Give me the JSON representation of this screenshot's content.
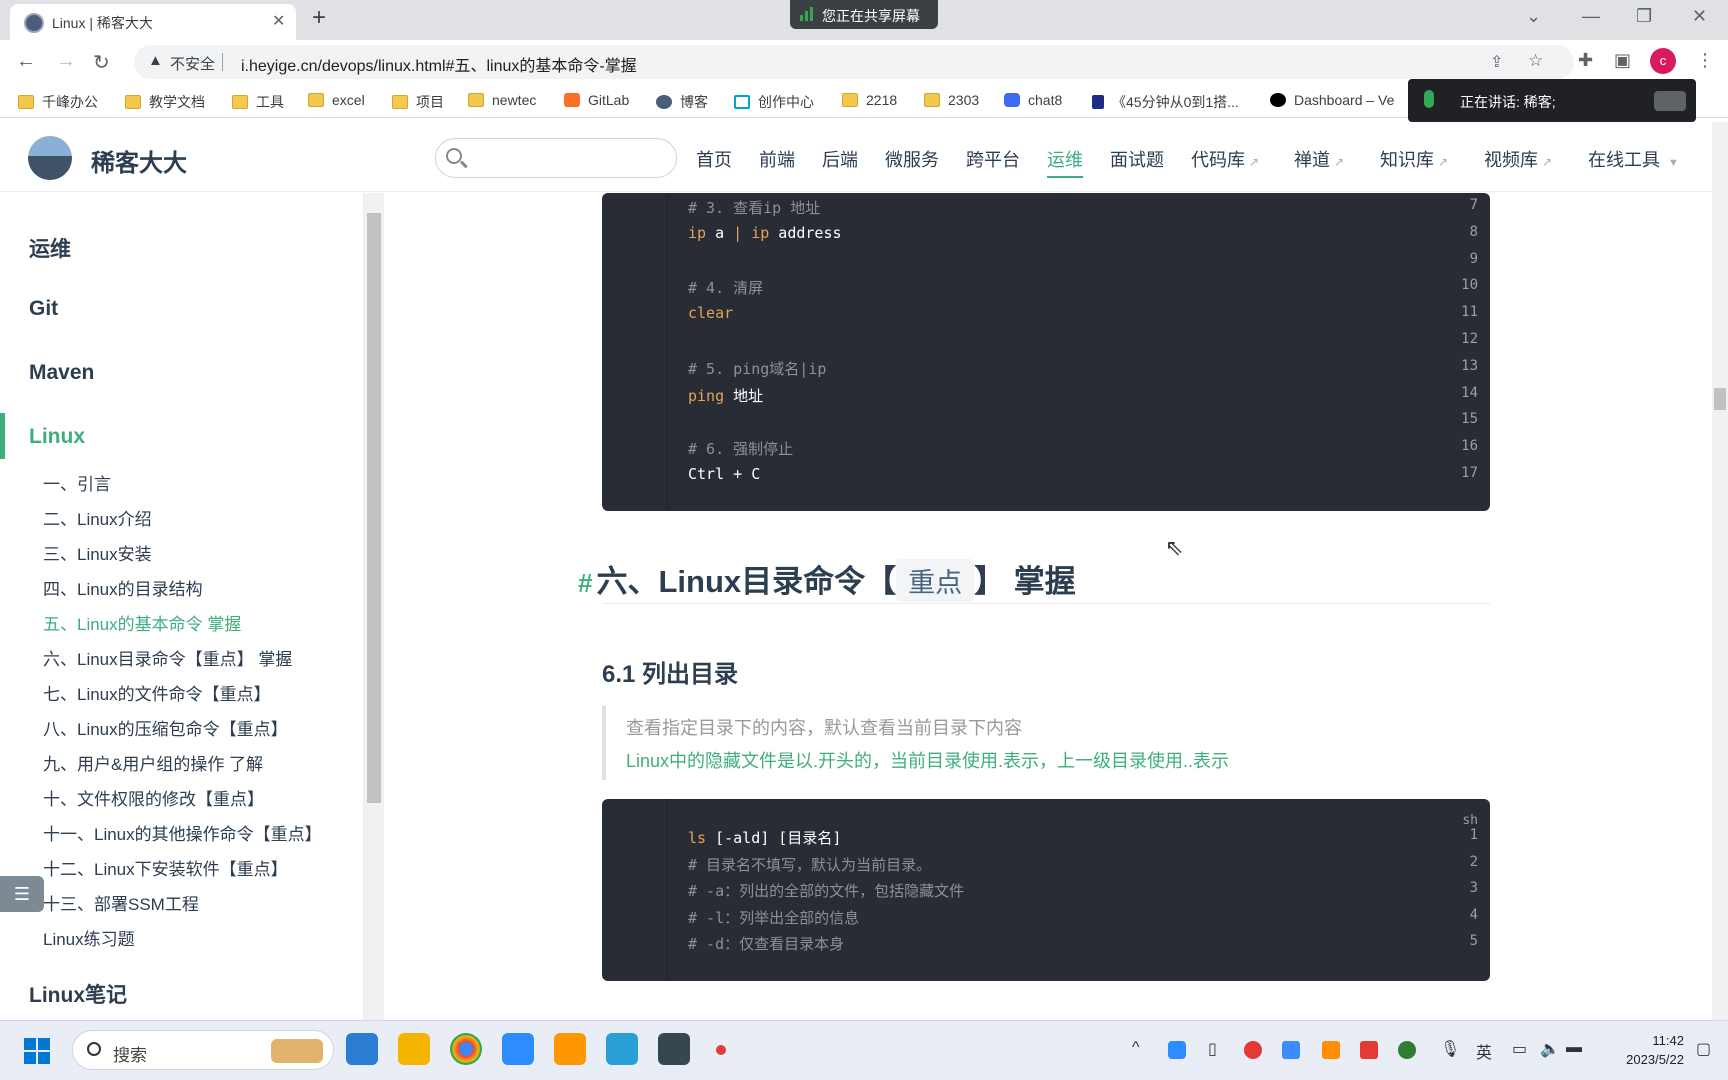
{
  "browser": {
    "tab_title": "Linux | 稀客大大",
    "sharing_banner": "您正在共享屏幕",
    "insecure_label": "不安全",
    "url": "i.heyige.cn/devops/linux.html#五、linux的基本命令-掌握",
    "profile_initial": "c",
    "bookmarks": [
      {
        "label": "千峰办公",
        "icon": "folder"
      },
      {
        "label": "教学文档",
        "icon": "folder"
      },
      {
        "label": "工具",
        "icon": "folder"
      },
      {
        "label": "excel",
        "icon": "folder"
      },
      {
        "label": "项目",
        "icon": "folder"
      },
      {
        "label": "newtec",
        "icon": "folder"
      },
      {
        "label": "GitLab",
        "icon": "gitlab-icon"
      },
      {
        "label": "博客",
        "icon": "blog-icon"
      },
      {
        "label": "创作中心",
        "icon": "bilibili-icon"
      },
      {
        "label": "2218",
        "icon": "folder"
      },
      {
        "label": "2303",
        "icon": "folder"
      },
      {
        "label": "chat8",
        "icon": "chat-icon"
      },
      {
        "label": "《45分钟从0到1搭...",
        "icon": "p-icon"
      },
      {
        "label": "Dashboard – Ve",
        "icon": "vercel-icon"
      }
    ],
    "speaking_label": "正在讲话:  稀客;"
  },
  "site": {
    "name": "稀客大大",
    "search_placeholder": "",
    "nav": [
      {
        "label": "首页",
        "external": false,
        "active": false
      },
      {
        "label": "前端",
        "external": false,
        "active": false
      },
      {
        "label": "后端",
        "external": false,
        "active": false
      },
      {
        "label": "微服务",
        "external": false,
        "active": false
      },
      {
        "label": "跨平台",
        "external": false,
        "active": false
      },
      {
        "label": "运维",
        "external": false,
        "active": true
      },
      {
        "label": "面试题",
        "external": false,
        "active": false
      },
      {
        "label": "代码库",
        "external": true,
        "active": false
      },
      {
        "label": "禅道",
        "external": true,
        "active": false
      },
      {
        "label": "知识库",
        "external": true,
        "active": false
      },
      {
        "label": "视频库",
        "external": true,
        "active": false
      },
      {
        "label": "在线工具",
        "external": false,
        "active": false
      }
    ]
  },
  "sidebar": {
    "groups": [
      "运维",
      "Git",
      "Maven",
      "Linux",
      "Linux笔记"
    ],
    "active_group": "Linux",
    "items": [
      "一、引言",
      "二、Linux介绍",
      "三、Linux安装",
      "四、Linux的目录结构",
      "五、Linux的基本命令 掌握",
      "六、Linux目录命令【重点】 掌握",
      "七、Linux的文件命令【重点】",
      "八、Linux的压缩包命令【重点】",
      "九、用户&用户组的操作 了解",
      "十、文件权限的修改【重点】",
      "十一、Linux的其他操作命令【重点】",
      "十二、Linux下安装软件【重点】",
      "十三、部署SSM工程",
      "Linux练习题"
    ],
    "active_item": "五、Linux的基本命令 掌握"
  },
  "content": {
    "code1": {
      "lines": [
        {
          "n": "7",
          "parts": [
            {
              "t": "# 3. 查看ip 地址",
              "c": "cm"
            }
          ]
        },
        {
          "n": "8",
          "parts": [
            {
              "t": "ip",
              "c": "kw"
            },
            {
              "t": " a ",
              "c": ""
            },
            {
              "t": "|",
              "c": "kw"
            },
            {
              "t": " ",
              "c": ""
            },
            {
              "t": "ip",
              "c": "kw"
            },
            {
              "t": " address",
              "c": ""
            }
          ]
        },
        {
          "n": "9",
          "parts": []
        },
        {
          "n": "10",
          "parts": [
            {
              "t": "# 4. 清屏",
              "c": "cm"
            }
          ]
        },
        {
          "n": "11",
          "parts": [
            {
              "t": "clear",
              "c": "kw"
            }
          ]
        },
        {
          "n": "12",
          "parts": []
        },
        {
          "n": "13",
          "parts": [
            {
              "t": "# 5. ping域名|ip",
              "c": "cm"
            }
          ]
        },
        {
          "n": "14",
          "parts": [
            {
              "t": "ping",
              "c": "kw"
            },
            {
              "t": " 地址",
              "c": ""
            }
          ]
        },
        {
          "n": "15",
          "parts": []
        },
        {
          "n": "16",
          "parts": [
            {
              "t": "# 6. 强制停止",
              "c": "cm"
            }
          ]
        },
        {
          "n": "17",
          "parts": [
            {
              "t": "Ctrl + C",
              "c": ""
            }
          ]
        }
      ]
    },
    "h2_prefix": "六、Linux目录命令【",
    "h2_tag": "重点",
    "h2_suffix": "】 掌握",
    "h3": "6.1 列出目录",
    "quote_line1": "查看指定目录下的内容，默认查看当前目录下内容",
    "quote_line2": "Linux中的隐藏文件是以.开头的，当前目录使用.表示，上一级目录使用..表示",
    "code2": {
      "lang": "sh",
      "lines": [
        {
          "n": "1",
          "parts": [
            {
              "t": "ls",
              "c": "kw"
            },
            {
              "t": " [-ald] [目录名]",
              "c": ""
            }
          ]
        },
        {
          "n": "2",
          "parts": [
            {
              "t": "# 目录名不填写，默认为当前目录。",
              "c": "cm"
            }
          ]
        },
        {
          "n": "3",
          "parts": [
            {
              "t": "# -a：列出的全部的文件，包括隐藏文件",
              "c": "cm"
            }
          ]
        },
        {
          "n": "4",
          "parts": [
            {
              "t": "# -l：列举出全部的信息",
              "c": "cm"
            }
          ]
        },
        {
          "n": "5",
          "parts": [
            {
              "t": "# -d：仅查看目录本身",
              "c": "cm"
            }
          ]
        }
      ]
    }
  },
  "taskbar": {
    "search_label": "搜索",
    "ime": "英",
    "time": "11:42",
    "date": "2023/5/22"
  }
}
